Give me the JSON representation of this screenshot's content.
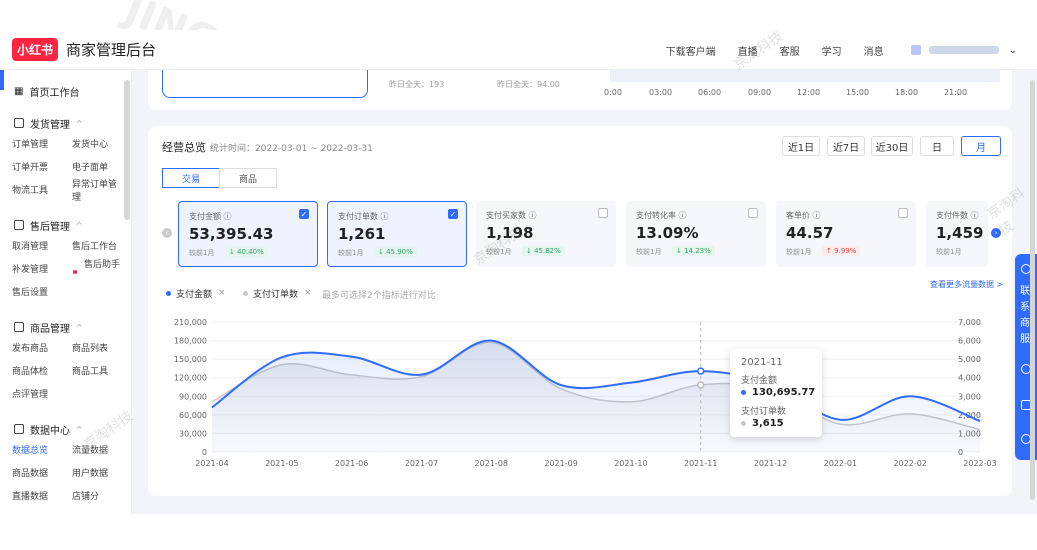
{
  "header": {
    "logo": "小红书",
    "title": "商家管理后台",
    "nav": [
      "下载客户端",
      "直播",
      "客服",
      "学习",
      "消息"
    ]
  },
  "sidebar": {
    "home": "首页工作台",
    "groups": [
      {
        "title": "发货管理",
        "rows": [
          [
            "订单管理",
            "发货中心"
          ],
          [
            "订单开票",
            "电子面单"
          ],
          [
            "物流工具",
            "异常订单管理"
          ]
        ]
      },
      {
        "title": "售后管理",
        "rows": [
          [
            "取消管理",
            "售后工作台"
          ],
          [
            "补发管理",
            "售后助手"
          ],
          [
            "售后设置",
            ""
          ]
        ]
      },
      {
        "title": "商品管理",
        "rows": [
          [
            "发布商品",
            "商品列表"
          ],
          [
            "商品体检",
            "商品工具"
          ],
          [
            "点评管理",
            ""
          ]
        ]
      },
      {
        "title": "数据中心",
        "rows": [
          [
            "数据总览",
            "流量数据"
          ],
          [
            "商品数据",
            "用户数据"
          ],
          [
            "直播数据",
            "店铺分"
          ]
        ]
      }
    ]
  },
  "top_panel": {
    "yesterday1": "昨日全天：193",
    "yesterday2": "昨日全天：94.00",
    "time_ticks": [
      "0:00",
      "03:00",
      "06:00",
      "09:00",
      "12:00",
      "15:00",
      "18:00",
      "21:00"
    ]
  },
  "overview": {
    "title": "经营总览",
    "period": "统计时间：2022-03-01 ~ 2022-03-31",
    "ranges": [
      "近1日",
      "近7日",
      "近30日",
      "日",
      "月"
    ],
    "active_range": "月",
    "tabs": [
      "交易",
      "商品"
    ],
    "metrics": [
      {
        "label": "支付金额 ⓘ",
        "value": "53,395.43",
        "cmp": "较前1月",
        "chg": "↓ 40.40%",
        "dir": "up",
        "checked": true
      },
      {
        "label": "支付订单数 ⓘ",
        "value": "1,261",
        "cmp": "较前1月",
        "chg": "↓ 45.90%",
        "dir": "up",
        "checked": true
      },
      {
        "label": "支付买家数 ⓘ",
        "value": "1,198",
        "cmp": "较前1月",
        "chg": "↓ 45.82%",
        "dir": "up",
        "checked": false
      },
      {
        "label": "支付转化率 ⓘ",
        "value": "13.09%",
        "cmp": "较前1月",
        "chg": "↓ 14.23%",
        "dir": "up",
        "checked": false
      },
      {
        "label": "客单价 ⓘ",
        "value": "44.57",
        "cmp": "较前1月",
        "chg": "↑ 9.99%",
        "dir": "down",
        "checked": false
      },
      {
        "label": "支付件数 ⓘ",
        "value": "1,459",
        "cmp": "较前1月",
        "chg": "",
        "dir": "up",
        "checked": false
      }
    ],
    "legend": [
      "支付金额",
      "支付订单数"
    ],
    "legend_hint": "最多可选择2个指标进行对比",
    "more_link": "查看更多流量数据 >"
  },
  "chart_data": {
    "type": "area",
    "x": [
      "2021-04",
      "2021-05",
      "2021-06",
      "2021-07",
      "2021-08",
      "2021-09",
      "2021-10",
      "2021-11",
      "2021-12",
      "2022-01",
      "2022-02",
      "2022-03"
    ],
    "y_left_ticks": [
      "210,000",
      "180,000",
      "150,000",
      "120,000",
      "90,000",
      "60,000",
      "30,000",
      "0"
    ],
    "y_right_ticks": [
      "7,000",
      "6,000",
      "5,000",
      "4,000",
      "3,000",
      "2,000",
      "1,000",
      "0"
    ],
    "ylim_left": [
      0,
      210000
    ],
    "ylim_right": [
      0,
      7000
    ],
    "series": [
      {
        "name": "支付金额",
        "axis": "left",
        "color": "#2f6bff",
        "values": [
          72000,
          153000,
          154000,
          125000,
          180000,
          108000,
          112000,
          130695.77,
          110000,
          52000,
          90000,
          50000
        ]
      },
      {
        "name": "支付订单数",
        "axis": "right",
        "color": "#c8c8c8",
        "values": [
          2700,
          4700,
          4150,
          4050,
          5900,
          3400,
          2700,
          3615,
          3400,
          1500,
          2050,
          1200
        ]
      }
    ],
    "tooltip": {
      "date": "2021-11",
      "l1": "支付金额",
      "v1": "130,695.77",
      "l2": "支付订单数",
      "v2": "3,615"
    }
  },
  "float_panel": {
    "text": "联系商服"
  },
  "watermarks": {
    "brand": "JINGTAO",
    "cn": "京淘科技"
  }
}
